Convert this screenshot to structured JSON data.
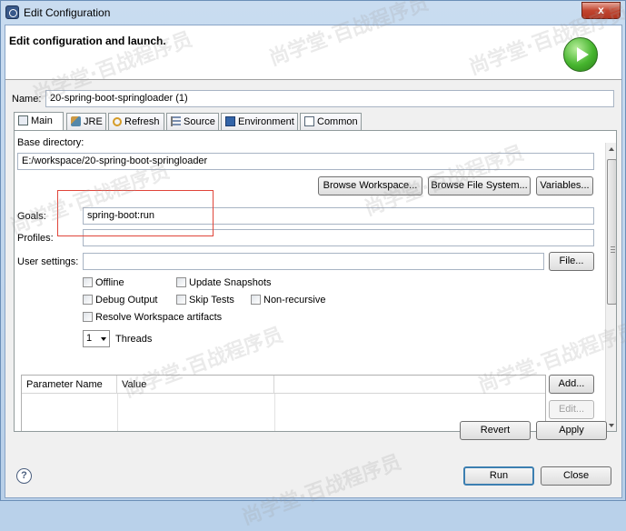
{
  "window": {
    "title": "Edit Configuration",
    "close_label": "x"
  },
  "banner": {
    "title": "Edit configuration and launch."
  },
  "name": {
    "label": "Name:",
    "value": "20-spring-boot-springloader (1)"
  },
  "tabs": [
    {
      "label": "Main",
      "icon": "main-tab-icon",
      "active": true
    },
    {
      "label": "JRE",
      "icon": "jre-icon"
    },
    {
      "label": "Refresh",
      "icon": "refresh-icon"
    },
    {
      "label": "Source",
      "icon": "source-icon"
    },
    {
      "label": "Environment",
      "icon": "environment-icon"
    },
    {
      "label": "Common",
      "icon": "common-icon"
    }
  ],
  "main": {
    "base_directory_label": "Base directory:",
    "base_directory_value": "E:/workspace/20-spring-boot-springloader",
    "browse_workspace": "Browse Workspace...",
    "browse_file_system": "Browse File System...",
    "variables": "Variables...",
    "goals_label": "Goals:",
    "goals_value": "spring-boot:run",
    "profiles_label": "Profiles:",
    "profiles_value": "",
    "user_settings_label": "User settings:",
    "user_settings_value": "",
    "file_button": "File...",
    "checkboxes": {
      "offline": "Offline",
      "update_snapshots": "Update Snapshots",
      "debug_output": "Debug Output",
      "skip_tests": "Skip Tests",
      "non_recursive": "Non-recursive",
      "resolve_workspace": "Resolve Workspace artifacts"
    },
    "threads_value": "1",
    "threads_label": "Threads",
    "table_headers": [
      "Parameter Name",
      "Value"
    ],
    "add_button": "Add...",
    "edit_button": "Edit..."
  },
  "footer": {
    "revert": "Revert",
    "apply": "Apply",
    "run": "Run",
    "close": "Close",
    "help": "?"
  },
  "watermark": "尚学堂·百战程序员"
}
